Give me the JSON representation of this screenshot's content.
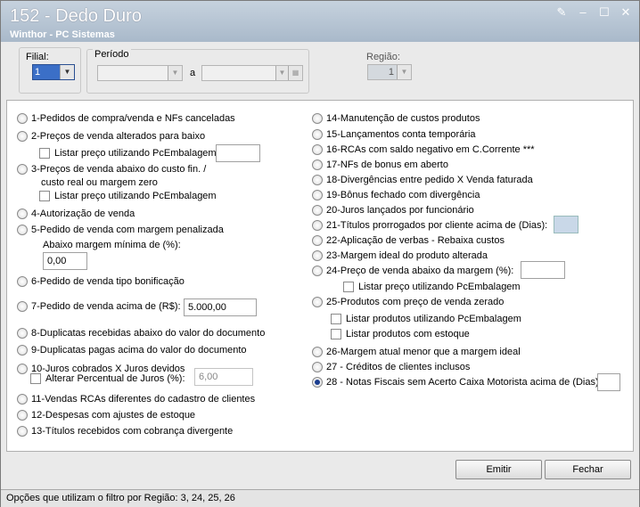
{
  "window": {
    "title": "152 - Dedo Duro",
    "subtitle": "Winthor - PC Sistemas"
  },
  "header": {
    "filial_label": "Filial:",
    "filial_value": "1",
    "periodo_label": "Período",
    "periodo_sep": "a",
    "regiao_label": "Região:",
    "regiao_value": "1"
  },
  "left": {
    "o1": "1-Pedidos de compra/venda e NFs canceladas",
    "o2": "2-Preços de venda alterados para baixo",
    "o2_chk": "Listar preço utilizando PcEmbalagem",
    "o3a": "3-Preços de venda abaixo do custo fin. /",
    "o3b": "custo real ou margem zero",
    "o3_chk": "Listar preço utilizando PcEmbalagem",
    "o4": "4-Autorização de venda",
    "o5": "5-Pedido de venda com margem penalizada",
    "o5_sub": "Abaixo margem mínima de (%):",
    "o5_val": "0,00",
    "o6": "6-Pedido de venda tipo bonificação",
    "o7": "7-Pedido de venda acima de (R$):",
    "o7_val": "5.000,00",
    "o8": "8-Duplicatas recebidas abaixo do valor do documento",
    "o9": "9-Duplicatas pagas acima do valor do documento",
    "o10": "10-Juros cobrados X Juros devidos",
    "o10_chk": "Alterar Percentual de Juros (%):",
    "o10_val": "6,00",
    "o11": "11-Vendas RCAs diferentes do cadastro de clientes",
    "o12": "12-Despesas com ajustes de estoque",
    "o13": "13-Títulos recebidos com cobrança divergente"
  },
  "right": {
    "o14": "14-Manutenção de custos produtos",
    "o15": "15-Lançamentos conta temporária",
    "o16": "16-RCAs com saldo negativo em C.Corrente ***",
    "o17": "17-NFs de bonus em aberto",
    "o18": "18-Divergências entre pedido X Venda faturada",
    "o19": "19-Bônus fechado com divergência",
    "o20": "20-Juros lançados por funcionário",
    "o21": "21-Títulos prorrogados por cliente acima de (Dias):",
    "o22": "22-Aplicação de verbas - Rebaixa custos",
    "o23": "23-Margem ideal do produto alterada",
    "o24": "24-Preço de venda abaixo da margem (%):",
    "o24_chk": "Listar preço utilizando PcEmbalagem",
    "o25": "25-Produtos com preço de venda zerado",
    "o25_chk1": "Listar produtos utilizando PcEmbalagem",
    "o25_chk2": "Listar produtos com estoque",
    "o26": "26-Margem atual menor que a margem ideal",
    "o27": "27 - Créditos de clientes inclusos",
    "o28": "28 - Notas Fiscais sem Acerto Caixa Motorista acima de (Dias):"
  },
  "buttons": {
    "emitir": "Emitir",
    "fechar": "Fechar"
  },
  "status": "Opções que utilizam o filtro por Região: 3, 24, 25, 26"
}
